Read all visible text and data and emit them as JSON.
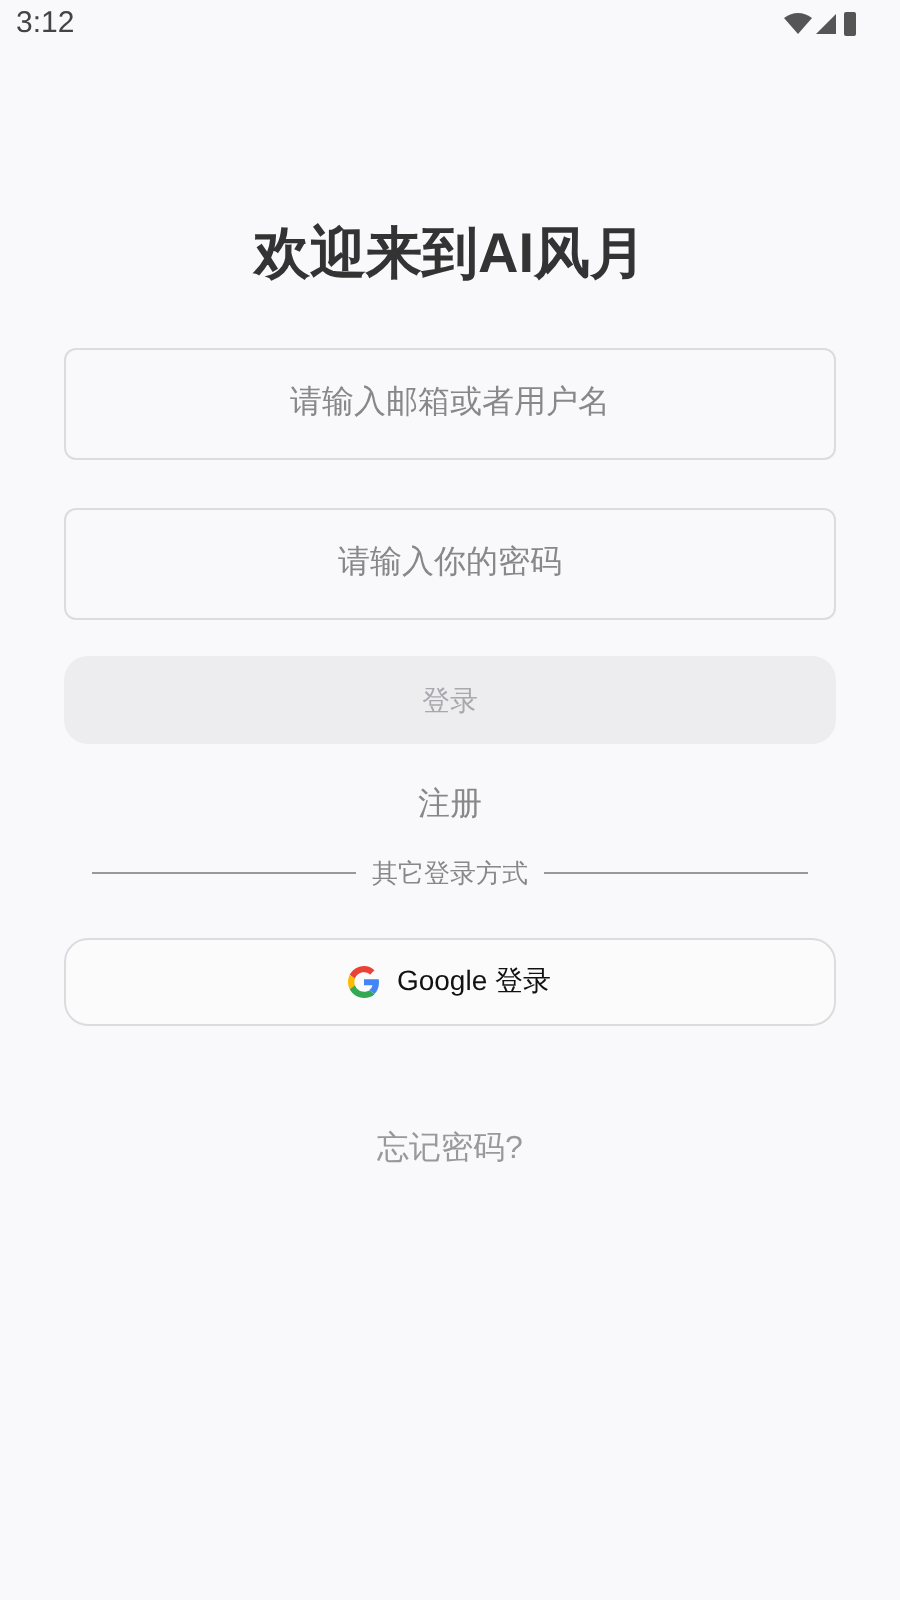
{
  "status_bar": {
    "time": "3:12"
  },
  "title": "欢迎来到AI风月",
  "fields": [
    {
      "placeholder": "请输入邮箱或者用户名"
    },
    {
      "placeholder": "请输入你的密码"
    }
  ],
  "login_button": {
    "label": "登录",
    "disabled": true
  },
  "register_link": "注册",
  "divider_label": "其它登录方式",
  "google_button": {
    "label": "Google 登录"
  },
  "forgot_link": "忘记密码?"
}
